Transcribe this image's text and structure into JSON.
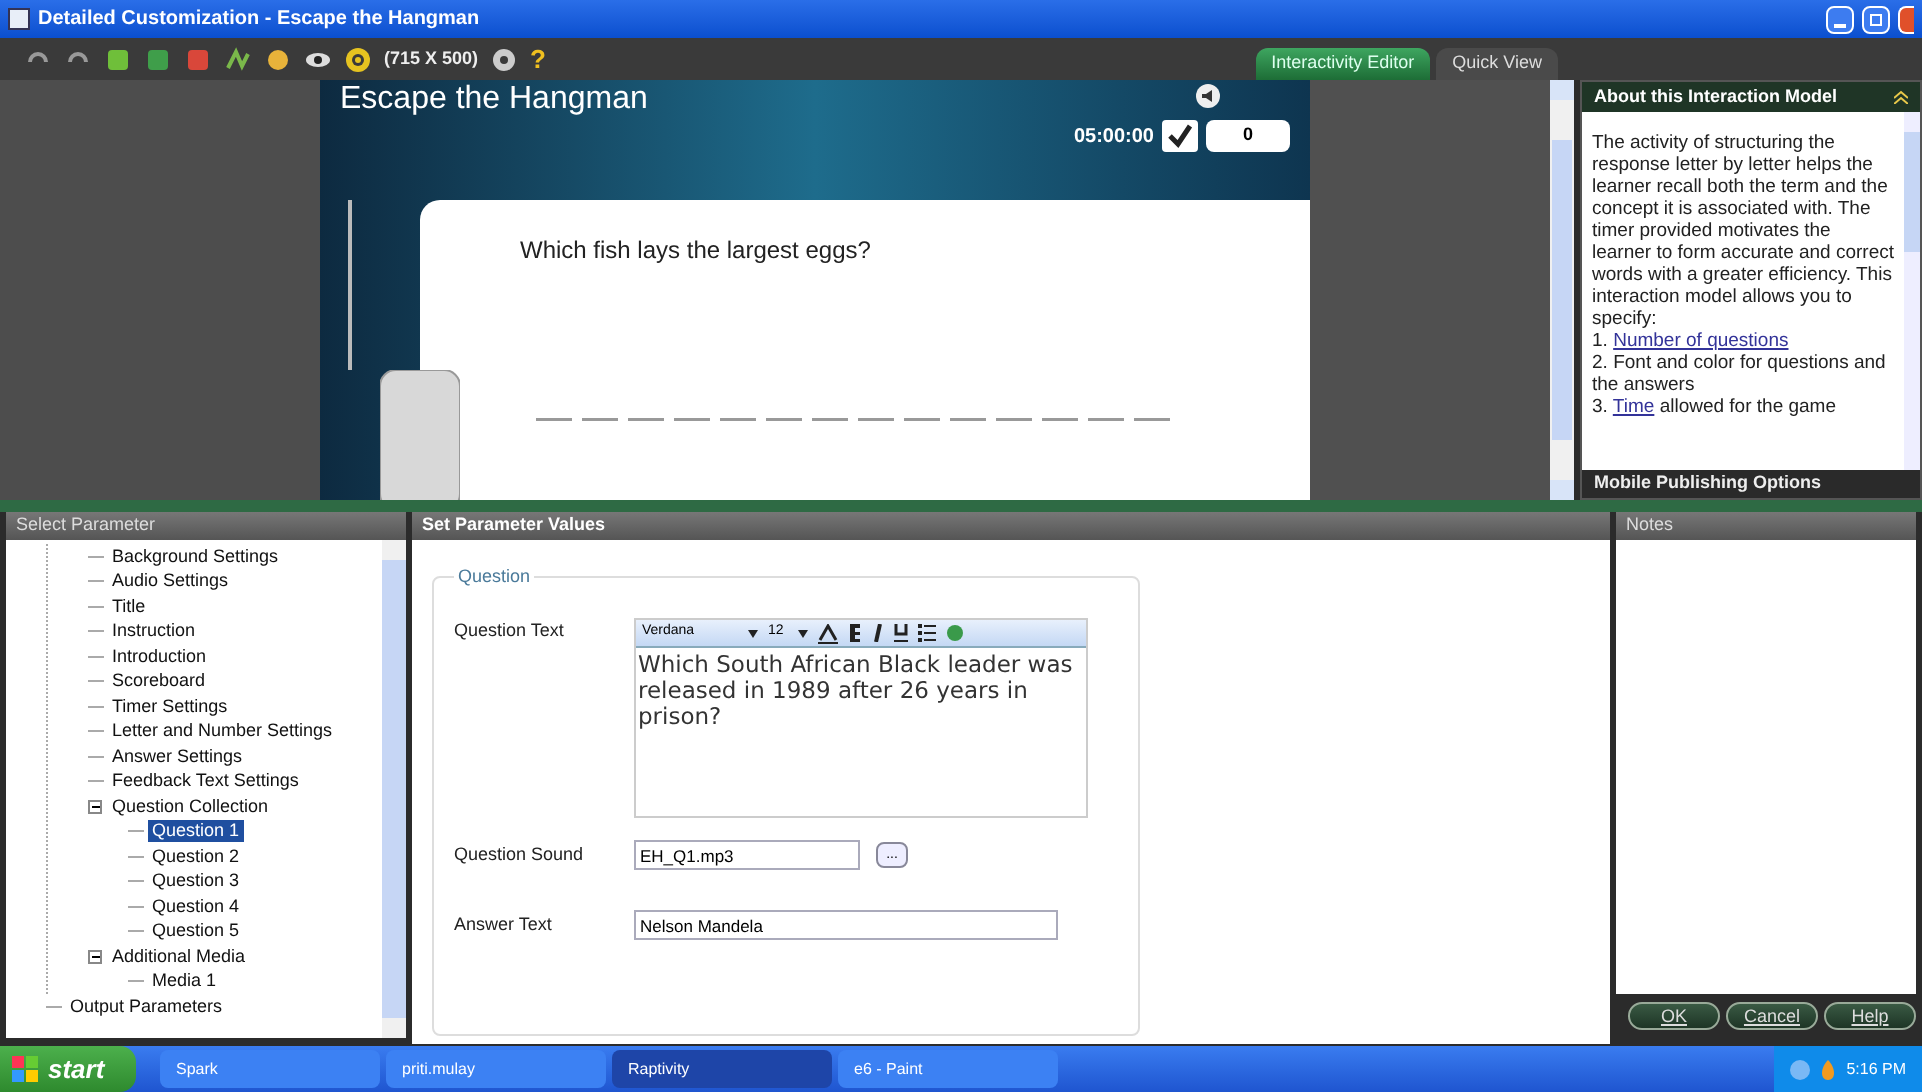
{
  "window": {
    "title": "Detailed Customization - Escape the Hangman"
  },
  "toolbar": {
    "size_label": "(715 X 500)",
    "help_glyph": "?"
  },
  "view_tabs": [
    {
      "label": "Interactivity Editor",
      "selected": true
    },
    {
      "label": "Quick View",
      "selected": false
    }
  ],
  "preview": {
    "game_title": "Escape the Hangman",
    "timer": "05:00:00",
    "score": "0",
    "question": "Which fish lays the largest eggs?"
  },
  "about_panel": {
    "title": "About this Interaction Model",
    "intro": "The activity of structuring the response letter by letter helps the learner recall both the term and the concept it is associated with. The timer provided motivates the learner to form accurate and correct words with a greater efficiency. This interaction model allows you to specify:",
    "items": [
      {
        "number": "1.",
        "link": "Number of questions"
      },
      {
        "number": "2.",
        "text": "Font and color for questions and the answers"
      },
      {
        "number": "3.",
        "link": "Time",
        "text": "allowed for the game"
      }
    ]
  },
  "mobile_panel": {
    "title": "Mobile Publishing Options"
  },
  "select_parameter": {
    "title": "Select Parameter",
    "tree": [
      {
        "label": "Background Settings",
        "selected": false
      },
      {
        "label": "Audio Settings",
        "selected": false
      },
      {
        "label": "Title",
        "selected": false
      },
      {
        "label": "Instruction",
        "selected": false
      },
      {
        "label": "Introduction",
        "selected": false
      },
      {
        "label": "Scoreboard",
        "selected": false
      },
      {
        "label": "Timer Settings",
        "selected": false
      },
      {
        "label": "Letter and Number Settings",
        "selected": false
      },
      {
        "label": "Answer Settings",
        "selected": false
      },
      {
        "label": "Feedback Text Settings",
        "selected": false
      },
      {
        "label": "Question Collection",
        "selected": false,
        "expanded": true,
        "children": [
          {
            "label": "Question 1",
            "selected": true
          },
          {
            "label": "Question 2",
            "selected": false
          },
          {
            "label": "Question 3",
            "selected": false
          },
          {
            "label": "Question 4",
            "selected": false
          },
          {
            "label": "Question 5",
            "selected": false
          }
        ]
      },
      {
        "label": "Additional Media",
        "selected": false,
        "expanded": true,
        "children": [
          {
            "label": "Media 1",
            "selected": false
          }
        ]
      }
    ],
    "outer_items": [
      {
        "label": "Output Parameters",
        "selected": false
      }
    ]
  },
  "set_parameter": {
    "title": "Set Parameter Values",
    "group": "Question",
    "question_text": {
      "label": "Question Text",
      "font": "Verdana",
      "size": "12",
      "value": "Which South African Black leader was released in 1989 after 26 years in prison?"
    },
    "question_sound": {
      "label": "Question Sound",
      "value": "EH_Q1.mp3",
      "browse": "..."
    },
    "answer_text": {
      "label": "Answer Text",
      "value": "Nelson Mandela"
    }
  },
  "notes": {
    "title": "Notes"
  },
  "buttons": [
    "OK",
    "Cancel",
    "Help"
  ],
  "taskbar": {
    "start": "start",
    "tasks": [
      {
        "label": "Spark",
        "selected": false
      },
      {
        "label": "priti.mulay",
        "selected": false
      },
      {
        "label": "Raptivity",
        "selected": true
      },
      {
        "label": "e6 - Paint",
        "selected": false
      }
    ],
    "clock": "5:16 PM"
  }
}
